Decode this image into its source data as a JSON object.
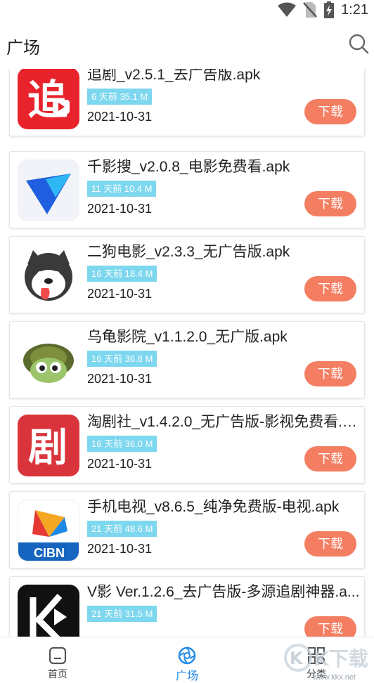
{
  "status_bar": {
    "time": "1:21"
  },
  "header": {
    "title": "广场"
  },
  "download_label": "下载",
  "apps": [
    {
      "name": "追剧_v2.5.1_去广告版.apk",
      "meta": "6 天前 35.1 M",
      "date": "2021-10-31",
      "icon": "zhuiju-app-icon",
      "icon_text": "追"
    },
    {
      "name": "千影搜_v2.0.8_电影免费看.apk",
      "meta": "11 天前 10.4 M",
      "date": "2021-10-31",
      "icon": "qianyingsou-app-icon"
    },
    {
      "name": "二狗电影_v2.3.3_无广告版.apk",
      "meta": "16 天前 18.4 M",
      "date": "2021-10-31",
      "icon": "ergou-app-icon"
    },
    {
      "name": "乌龟影院_v1.1.2.0_无广版.apk",
      "meta": "16 天前 36.8 M",
      "date": "2021-10-31",
      "icon": "wugui-app-icon"
    },
    {
      "name": "淘剧社_v1.4.2.0_无广告版-影视免费看.a...",
      "meta": "16 天前 36.0 M",
      "date": "2021-10-31",
      "icon": "taojushe-app-icon",
      "icon_text": "剧"
    },
    {
      "name": "手机电视_v8.6.5_纯净免费版-电视.apk",
      "meta": "21 天前 48.6 M",
      "date": "2021-10-31",
      "icon": "cibn-app-icon",
      "icon_text": "CIBN"
    },
    {
      "name": "V影 Ver.1.2.6_去广告版-多源追剧神器.a...",
      "meta": "21 天前 31.5 M",
      "date": "",
      "icon": "vying-app-icon"
    }
  ],
  "bottom_nav": [
    {
      "label": "首页",
      "icon": "home-icon"
    },
    {
      "label": "广场",
      "icon": "square-icon",
      "active": true
    },
    {
      "label": "分类",
      "icon": "category-icon"
    }
  ],
  "watermark": {
    "text": "www.kkx.net",
    "logo_text": "KK下载"
  },
  "colors": {
    "accent": "#1e88e5",
    "download": "#f47e62",
    "badge": "#7dd7ee"
  }
}
